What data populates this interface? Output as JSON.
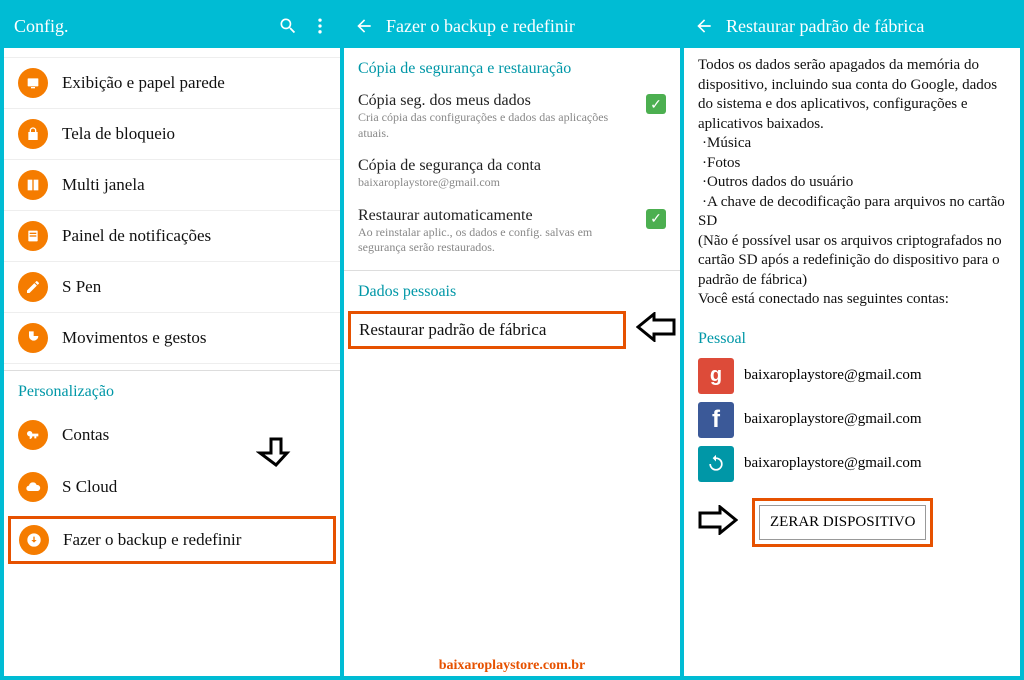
{
  "panel1": {
    "title": "Config.",
    "items": [
      {
        "label": "Exibição e papel parede"
      },
      {
        "label": "Tela de bloqueio"
      },
      {
        "label": "Multi janela"
      },
      {
        "label": "Painel de notificações"
      },
      {
        "label": "S Pen"
      },
      {
        "label": "Movimentos e gestos"
      }
    ],
    "section": "Personalização",
    "items2": [
      {
        "label": "Contas"
      },
      {
        "label": "S Cloud"
      }
    ],
    "highlight": "Fazer o backup e redefinir"
  },
  "panel2": {
    "title": "Fazer o backup e redefinir",
    "section1": "Cópia de segurança e restauração",
    "backup1": {
      "title": "Cópia seg. dos meus dados",
      "sub": "Cria cópia das configurações e dados das aplicações atuais."
    },
    "backup2": {
      "title": "Cópia de segurança da conta",
      "sub": "baixaroplaystore@gmail.com"
    },
    "backup3": {
      "title": "Restaurar automaticamente",
      "sub": "Ao reinstalar aplic., os dados e config. salvas em segurança serão restaurados."
    },
    "section2": "Dados pessoais",
    "highlight": "Restaurar padrão de fábrica",
    "watermark": "baixaroplaystore.com.br"
  },
  "panel3": {
    "title": "Restaurar padrão de fábrica",
    "warning": "Todos os dados serão apagados da memória do dispositivo, incluindo sua conta do Google, dados do sistema e dos aplicativos, configurações e aplicativos baixados.",
    "bullets": [
      "·Música",
      "·Fotos",
      "·Outros dados do usuário",
      "·A chave de decodificação para arquivos no cartão SD"
    ],
    "paren": "(Não é possível usar os arquivos criptografados no cartão SD após a redefinição do dispositivo para o padrão de fábrica)",
    "connected": "Você está conectado nas seguintes contas:",
    "section": "Pessoal",
    "accounts": [
      {
        "email": "baixaroplaystore@gmail.com"
      },
      {
        "email": "baixaroplaystore@gmail.com"
      },
      {
        "email": "baixaroplaystore@gmail.com"
      }
    ],
    "button": "ZERAR DISPOSITIVO"
  }
}
